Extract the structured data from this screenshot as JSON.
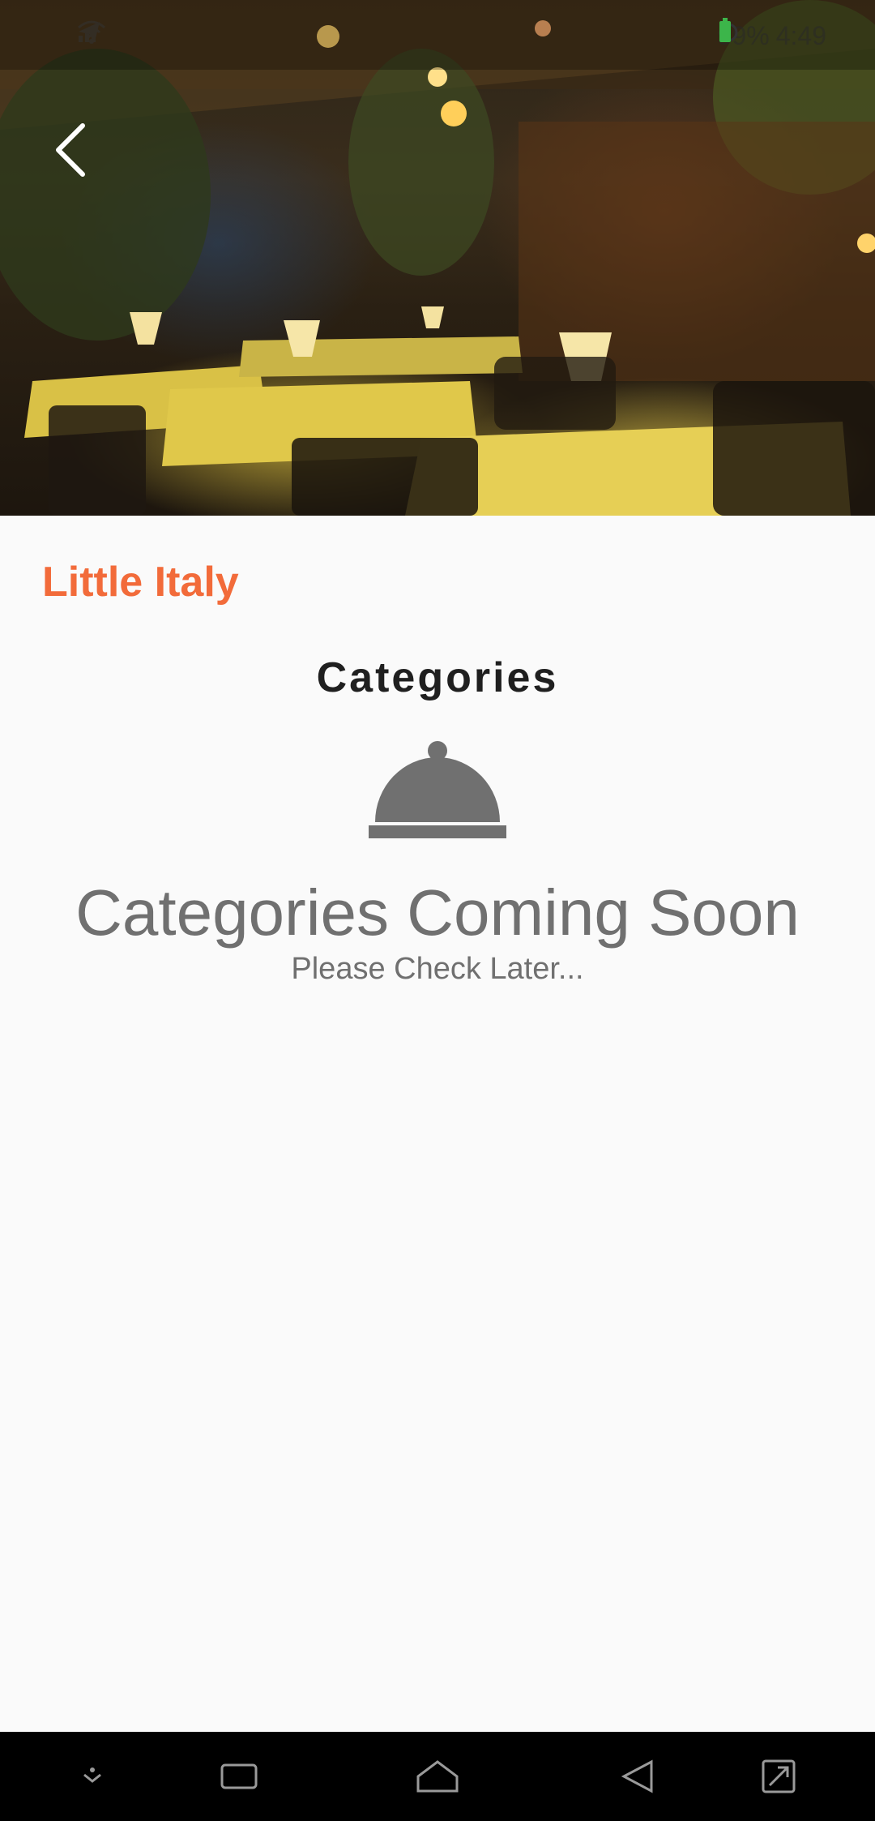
{
  "status_bar": {
    "battery": "59%",
    "time": "4:49"
  },
  "hero": {
    "description_icon": "restaurant-photo"
  },
  "restaurant": {
    "name": "Little Italy"
  },
  "section": {
    "title": "Categories"
  },
  "empty_state": {
    "icon": "cloche-icon",
    "title": "Categories Coming Soon",
    "subtitle": "Please Check Later..."
  },
  "nav_bar": {
    "buttons": [
      "notification-pull-icon",
      "recents-icon",
      "home-icon",
      "back-icon",
      "screenshot-icon"
    ]
  },
  "colors": {
    "accent": "#f26b3a",
    "muted": "#707070",
    "background": "#fafafa"
  }
}
